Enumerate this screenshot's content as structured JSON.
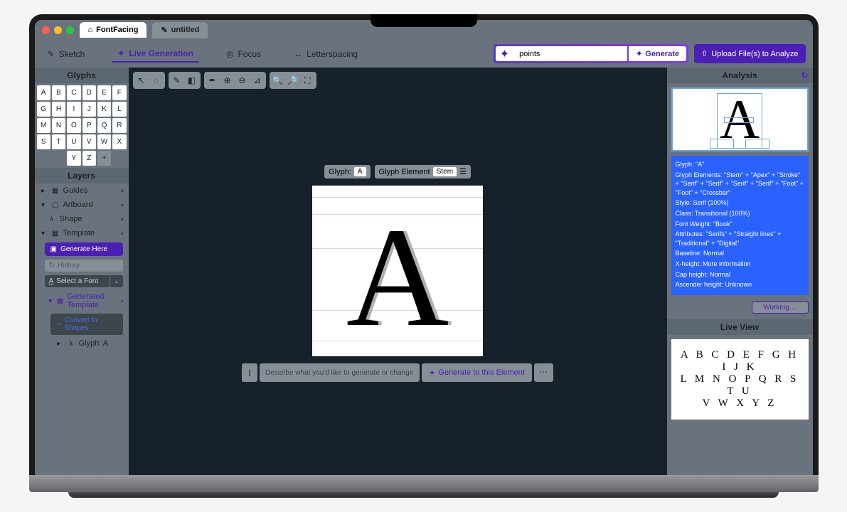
{
  "tabs": {
    "home": "FontFacing",
    "doc": "untitled"
  },
  "toolbar": {
    "sketch": "Sketch",
    "livegen": "Live Generation",
    "focus": "Focus",
    "letterspacing": "Letterspacing",
    "search_value": "points",
    "generate": "Generate",
    "upload": "Upload File(s) to Analyze"
  },
  "sidebar": {
    "glyphs_title": "Glyphs",
    "glyphs": [
      "A",
      "B",
      "C",
      "D",
      "E",
      "F",
      "G",
      "H",
      "I",
      "J",
      "K",
      "L",
      "M",
      "N",
      "O",
      "P",
      "Q",
      "R",
      "S",
      "T",
      "U",
      "V",
      "W",
      "X",
      "Y",
      "Z",
      "+"
    ],
    "layers_title": "Layers",
    "guides": "Guides",
    "artboard": "Artboard",
    "shape": "Shape",
    "template": "Template",
    "generate_here": "Generate Here",
    "history": "History",
    "select_font": "Select a Font",
    "generated_template": "Generated Template",
    "convert_shapes": "Convert to Shapes",
    "glyph_a": "Glyph: A"
  },
  "canvas": {
    "glyph_label": "Glyph:",
    "glyph_value": "A",
    "element_label": "Glyph Element",
    "element_value": "Stem",
    "letter": "A",
    "prompt_placeholder": "Describe what you'd like to generate or change about this letterform",
    "gen_elem": "Generate to this Element"
  },
  "analysis": {
    "title": "Analysis",
    "live_title": "Live View",
    "glyph": "Glyph: \"A\"",
    "elements": "Glyph Elements: \"Stem\" + \"Apex\" + \"Stroke\" + \"Serif\" + \"Serif\" + \"Serif\" + \"Serif\" + \"Foot\" + \"Foot\" + \"Crossbar\"",
    "style": "Style: Serif (100%)",
    "class": "Class: Transitional (100%)",
    "weight": "Font Weight: \"Book\"",
    "attrs": "Attributes: \"Serifs\" + \"Straight lines\" + \"Traditional\" + \"Digital\"",
    "baseline": "Baseline: Normal",
    "xheight": "X-height: More information",
    "capheight": "Cap height: Normal",
    "ascender": "Ascender height: Unknown",
    "working": "Working…",
    "lv_row1": "A B C D E F G H I J K",
    "lv_row2": "L M N O P Q R S T U",
    "lv_row3": "V W X Y Z"
  }
}
